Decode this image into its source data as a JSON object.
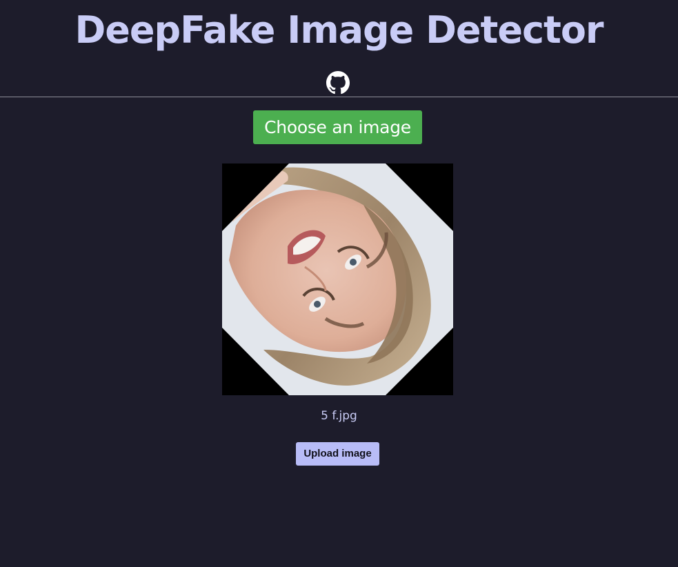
{
  "header": {
    "title": "DeepFake Image Detector",
    "github_icon": "github-icon"
  },
  "upload": {
    "choose_label": "Choose an image",
    "filename": "5 f.jpg",
    "upload_label": "Upload image"
  },
  "preview": {
    "alt": "Uploaded face image (rotated)"
  },
  "colors": {
    "background": "#1d1c2b",
    "title": "#c9ccf6",
    "choose_button": "#4caf50",
    "upload_button": "#b8bcf7"
  }
}
